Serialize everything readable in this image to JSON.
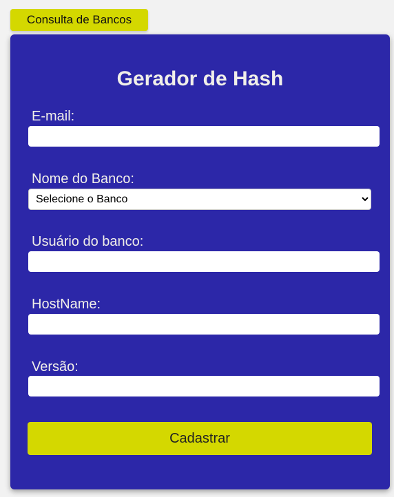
{
  "header": {
    "consulta_label": "Consulta de Bancos"
  },
  "form": {
    "title": "Gerador de Hash",
    "email_label": "E-mail:",
    "email_value": "",
    "banco_label": "Nome do Banco:",
    "banco_selected": "Selecione o Banco",
    "usuario_label": "Usuário do banco:",
    "usuario_value": "",
    "hostname_label": "HostName:",
    "hostname_value": "",
    "versao_label": "Versão:",
    "versao_value": "",
    "submit_label": "Cadastrar"
  },
  "colors": {
    "card_background": "#2c27a8",
    "accent_yellow": "#d4d800",
    "label_text": "#f1efe9",
    "page_background": "#f2f2f2"
  }
}
